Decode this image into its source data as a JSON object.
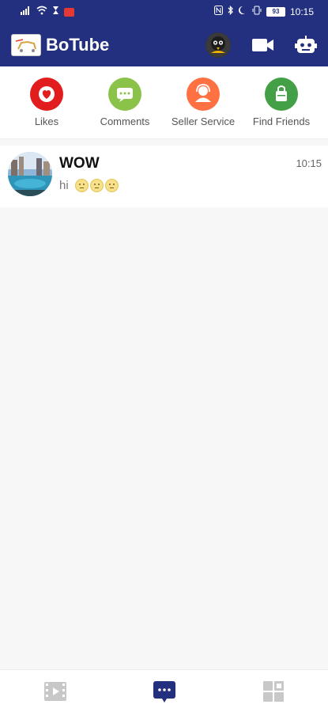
{
  "status_bar": {
    "battery": "93",
    "time": "10:15",
    "icons": [
      "signal-icon",
      "wifi-icon",
      "hourglass-icon",
      "notification-badge-icon",
      "nfc-icon",
      "bluetooth-icon",
      "moon-icon",
      "vibrate-icon",
      "battery-icon"
    ]
  },
  "app_bar": {
    "title": "BoTube",
    "icons": [
      "app-logo",
      "profile-avatar",
      "video-camera-icon",
      "robot-icon"
    ]
  },
  "quick_actions": [
    {
      "label": "Likes",
      "color": "#e11d1d",
      "icon": "heart-icon"
    },
    {
      "label": "Comments",
      "color": "#8bc34a",
      "icon": "chat-icon"
    },
    {
      "label": "Seller Service",
      "color": "#ff7043",
      "icon": "person-icon"
    },
    {
      "label": "Find Friends",
      "color": "#43a047",
      "icon": "add-friend-icon"
    }
  ],
  "chats": [
    {
      "name": "WOW",
      "time": "10:15",
      "preview": "hi",
      "emojis": 3
    }
  ],
  "bottom_nav": {
    "tabs": [
      "video-tab-icon",
      "messages-tab-icon",
      "apps-tab-icon"
    ],
    "active": "messages-tab-icon",
    "active_color": "#22307f",
    "inactive_color": "#c8c8c8"
  }
}
